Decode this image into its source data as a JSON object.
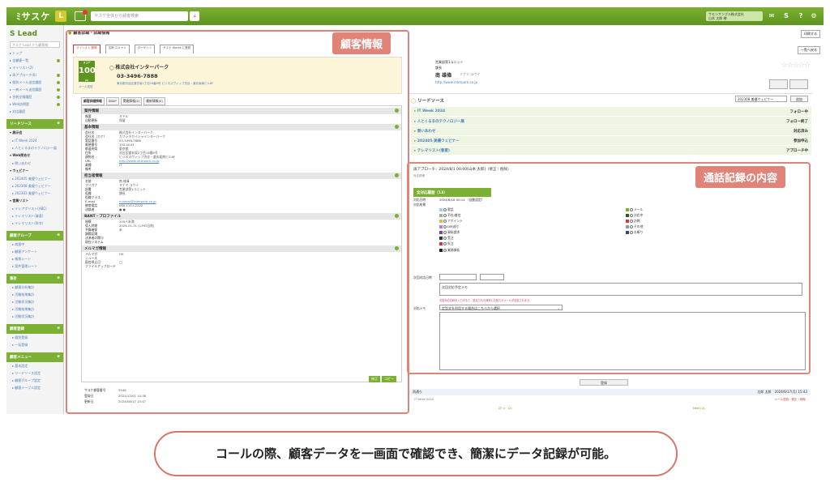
{
  "topbar": {
    "logo": "ﾐサスケ",
    "badge": "L",
    "search_placeholder": "サスケ全体から顧客検索",
    "user_line1": "サモンサンプル株式会社",
    "user_line2": "山本 太郎 様",
    "icons": [
      "mail-icon",
      "logo-icon",
      "help-icon",
      "gear-icon"
    ],
    "accent": "#6ca42a"
  },
  "sidebar": {
    "logo": "S Lead",
    "search_placeholder": "サスケ Lead から顧客検",
    "top_items": [
      "トップ",
      "全顧客一覧",
      "マイリスト(2)",
      "再アプローチ(6)",
      "個別メール送信履歴",
      "一斉メール送信履歴",
      "名刺交換履歴",
      "Web訪問歴",
      "対応履歴"
    ],
    "sections": [
      {
        "title": "リードソース",
        "items": [
          "展示会",
          "IT Week 2024",
          "人とくるまのテクノロジー展",
          "Web問合せ",
          "問いあわせ",
          "ウェビナー",
          "202405 美優ウェビナー",
          "202308 美優ウェビナー",
          "202303 美優ウェビナー",
          "営業リスト",
          "テレアポリスト(ABC)",
          "テレマリスト(春夏)",
          "テレマリスト(秋冬)"
        ]
      },
      {
        "title": "顧客グループ",
        "items": [
          "商談中",
          "顧客アンケート",
          "帳票シート",
          "案件管理シート"
        ]
      },
      {
        "title": "集計",
        "items": [
          "顧客分析集計",
          "活動結果集計",
          "活動状況集計",
          "活動結果集計",
          "活動状況集計"
        ]
      },
      {
        "title": "顧客登録",
        "items": [
          "個別登録",
          "一括登録"
        ]
      },
      {
        "title": "顧客メニュー",
        "items": [
          "基本設定",
          "リードソース設定",
          "顧客グループ設定",
          "顧客テーブル設定"
        ]
      }
    ]
  },
  "main": {
    "breadcrumb": "顧客詳細・詳細情報",
    "print_label": "印刷する",
    "back_label": "一覧へ戻る",
    "list_tabs": [
      "マイリスト 登録",
      "名刺 スキャン",
      "ターゲット",
      "サスケ Works に登録"
    ]
  },
  "labels": {
    "customer_info": "顧客情報",
    "call_log": "通話記録の内容"
  },
  "company": {
    "score": "100",
    "score_unit": "pt",
    "score_tag": "スコア",
    "name": "株式会社インターパーク",
    "phone": "03-3496-7888",
    "address": "東京都渋谷区道玄坂2丁目16番8号 ビジネスヴィップ渋谷・道玄坂南ビル8F",
    "mail_link": "メール送信"
  },
  "contact": {
    "dept": "営業部第1ユニット",
    "title": "課長",
    "name": "南 雄偉",
    "kana": "ミナミ ユウイ",
    "url": "http://www.interpark.co.jp"
  },
  "detail_tabs": [
    "顧客詳細情報",
    "SBAP",
    "関連情報(2)",
    "最新情報(0)"
  ],
  "sections": [
    {
      "title": "案件情報",
      "rows": [
        [
          "概要",
          "ミドル"
        ],
        [
          "自動更新",
          "保留"
        ]
      ]
    },
    {
      "title": "基本情報",
      "rows": [
        [
          "会社名",
          "株式会社インターパーク"
        ],
        [
          "会社名（カナ）",
          "カブシキガイシャインターパーク"
        ],
        [
          "電話番号",
          "03-3496-7888"
        ],
        [
          "郵便番号",
          "150-0043"
        ],
        [
          "都道府県",
          "東京都"
        ],
        [
          "住所",
          "渋谷区道玄坂2丁目16番8号"
        ],
        [
          "建物名",
          "ビジネスヴィップ渋谷・道玄坂南ビル8F"
        ],
        [
          "URL",
          "http://www.interpark.co.jp"
        ],
        [
          "業種",
          "IT"
        ],
        [
          "備考",
          ""
        ]
      ]
    },
    {
      "title": "担当者情報",
      "rows": [
        [
          "名前",
          "南 雄偉"
        ],
        [
          "フリガナ",
          "ミナミ ユウイ"
        ],
        [
          "部署",
          "営業部第1ユニット"
        ],
        [
          "役職",
          "課長"
        ],
        [
          "役職クラス",
          ""
        ],
        [
          "E-mail",
          "minami@interpark.co.jp"
        ],
        [
          "携帯電話",
          "080-1111-2222"
        ],
        [
          "決裁者",
          "● ●"
        ]
      ]
    },
    {
      "title": "BANT・プロファイル",
      "rows": [
        [
          "規模",
          "100人未満"
        ],
        [
          "導入時期",
          "2024-01-31 (1393日前)"
        ],
        [
          "予算確保",
          "未"
        ],
        [
          "課題認識",
          ""
        ],
        [
          "決済者の関与",
          ""
        ],
        [
          "現在システム",
          ""
        ]
      ]
    },
    {
      "title": "メルマガ情報",
      "rows": [
        [
          "メルマガ",
          "OK"
        ],
        [
          "ニュース",
          ""
        ],
        [
          "配信停止日",
          "◯"
        ],
        [
          "ファイルアップロード",
          ""
        ]
      ]
    }
  ],
  "actions": [
    "修正",
    "コピー"
  ],
  "meta": [
    [
      "サスケ顧客番号",
      "5546"
    ],
    [
      "登録日",
      "2021/12/01 14:38"
    ],
    [
      "更新日",
      "2024/08/17 15:47"
    ]
  ],
  "lead_source": {
    "title": "リードソース",
    "select_value": "202308 美優ウェビナー",
    "add_label": "追加",
    "rows": [
      {
        "name": "IT Week 2024",
        "status": "フォロー中"
      },
      {
        "name": "人とくるまのテクノロジー展",
        "status": "フォロー終了"
      },
      {
        "name": "問いあわせ",
        "status": "対応済み"
      },
      {
        "name": "202405 美優ウェビナー",
        "status": "参加申込"
      },
      {
        "name": "テレマリスト(春夏)",
        "status": "アプローチ中"
      }
    ]
  },
  "call": {
    "header": "再アプローチ：2024/8/1 00:00[山本 太郎]（修正｜削除）",
    "sub": "対応詳細",
    "tab": "全対応履歴（13）",
    "date_label": "対応日時",
    "date_value": "2024/6/18 00:14 （自動設定）",
    "result_label": "対応結果",
    "checks_left": [
      "電話",
      "不在/着信",
      "アポイント",
      "DM送付",
      "資料請求",
      "受注",
      "失注"
    ],
    "checks_right": [
      "メール",
      "対応中",
      "訪問",
      "その他",
      "お断り"
    ],
    "other_label": "業務課長",
    "next_label": "次回対応日時",
    "next_placeholder": "次回対応予定メモ",
    "warning": "次回対応日時を入力すると、設定された時刻にお知らせメールが送信されます。",
    "memo_label": "対応メモ",
    "memo_select": "定型文を利用する場合はこちらから選択",
    "register_button": "登録"
  },
  "history": {
    "title": "再通り",
    "user": "太郎 太郎",
    "datetime": "2024/6/17(月) 15:43",
    "links": "メール送信｜修正｜削除",
    "source": "IT Week 2024",
    "count": "ﾛｸﾞｲﾝﾞ (2)",
    "next": "Next (2)"
  },
  "caption": "コールの際、顧客データを一画面で確認でき、簡潔にデータ記録が可能。"
}
